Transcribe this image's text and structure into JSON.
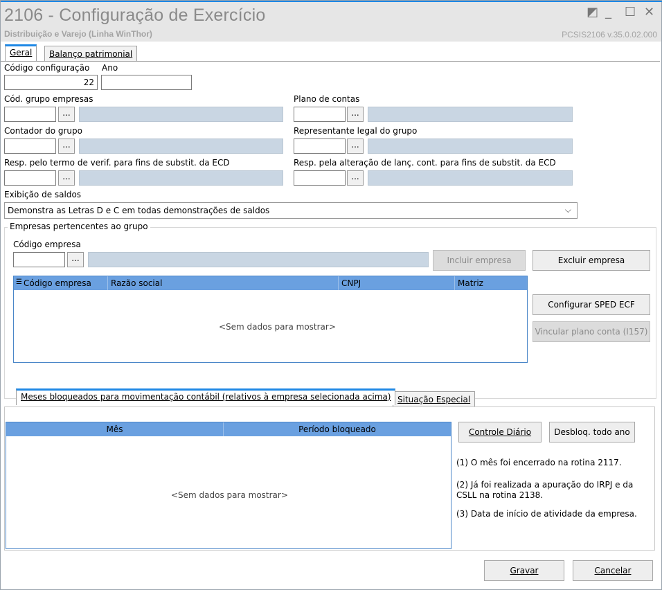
{
  "window": {
    "title": "2106 - Configuração de Exercício",
    "subtitle": "Distribuição e Varejo (Linha WinThor)",
    "version": "PCSIS2106  v.35.0.02.000",
    "controls": {
      "restore": "◩",
      "minimize": "_",
      "maximize": "☐",
      "close": "✕"
    }
  },
  "tabs": {
    "geral": "Geral",
    "balanco": "Balanço patrimonial"
  },
  "form": {
    "codigo_configuracao": {
      "label": "Código configuração",
      "value": "22"
    },
    "ano": {
      "label": "Ano",
      "value": ""
    },
    "cod_grupo_empresas": {
      "label": "Cód. grupo empresas",
      "value": ""
    },
    "plano_de_contas": {
      "label": "Plano de contas",
      "value": ""
    },
    "contador_do_grupo": {
      "label": "Contador do grupo",
      "value": ""
    },
    "representante_legal": {
      "label": "Representante legal do grupo",
      "value": ""
    },
    "resp_termo": {
      "label": "Resp. pelo termo de verif. para fins de substit. da ECD",
      "value": ""
    },
    "resp_alteracao": {
      "label": "Resp. pela alteração de lanç. cont. para fins de substit. da ECD",
      "value": ""
    },
    "exibicao_saldos": {
      "label": "Exibição de saldos",
      "value": "Demonstra as Letras D e C em todas demonstrações de saldos"
    },
    "lookup_button": "..."
  },
  "empresas": {
    "group_title": "Empresas pertencentes ao grupo",
    "codigo_label": "Código empresa",
    "incluir": "Incluir empresa",
    "excluir": "Excluir empresa",
    "configurar_sped": "Configurar SPED ECF",
    "vincular": "Vincular plano conta (I157)",
    "columns": [
      "Código empresa",
      "Razão social",
      "CNPJ",
      "Matriz"
    ],
    "empty": "<Sem dados para mostrar>"
  },
  "meses": {
    "tab_meses": "Meses bloqueados para movimentação contábil (relativos à empresa selecionada acima)",
    "tab_situacao": "Situação Especial",
    "columns": [
      "Mês",
      "Período bloqueado"
    ],
    "empty": "<Sem dados para mostrar>",
    "controle_diario": "Controle Diário",
    "desbloq": "Desbloq. todo ano",
    "notes": [
      "(1)  O mês foi encerrado na rotina 2117.",
      "(2)  Já foi realizada a apuração do IRPJ e da CSLL na rotina 2138.",
      "(3)  Data de início de atividade da empresa."
    ]
  },
  "footer": {
    "gravar": "Gravar",
    "cancelar": "Cancelar"
  }
}
